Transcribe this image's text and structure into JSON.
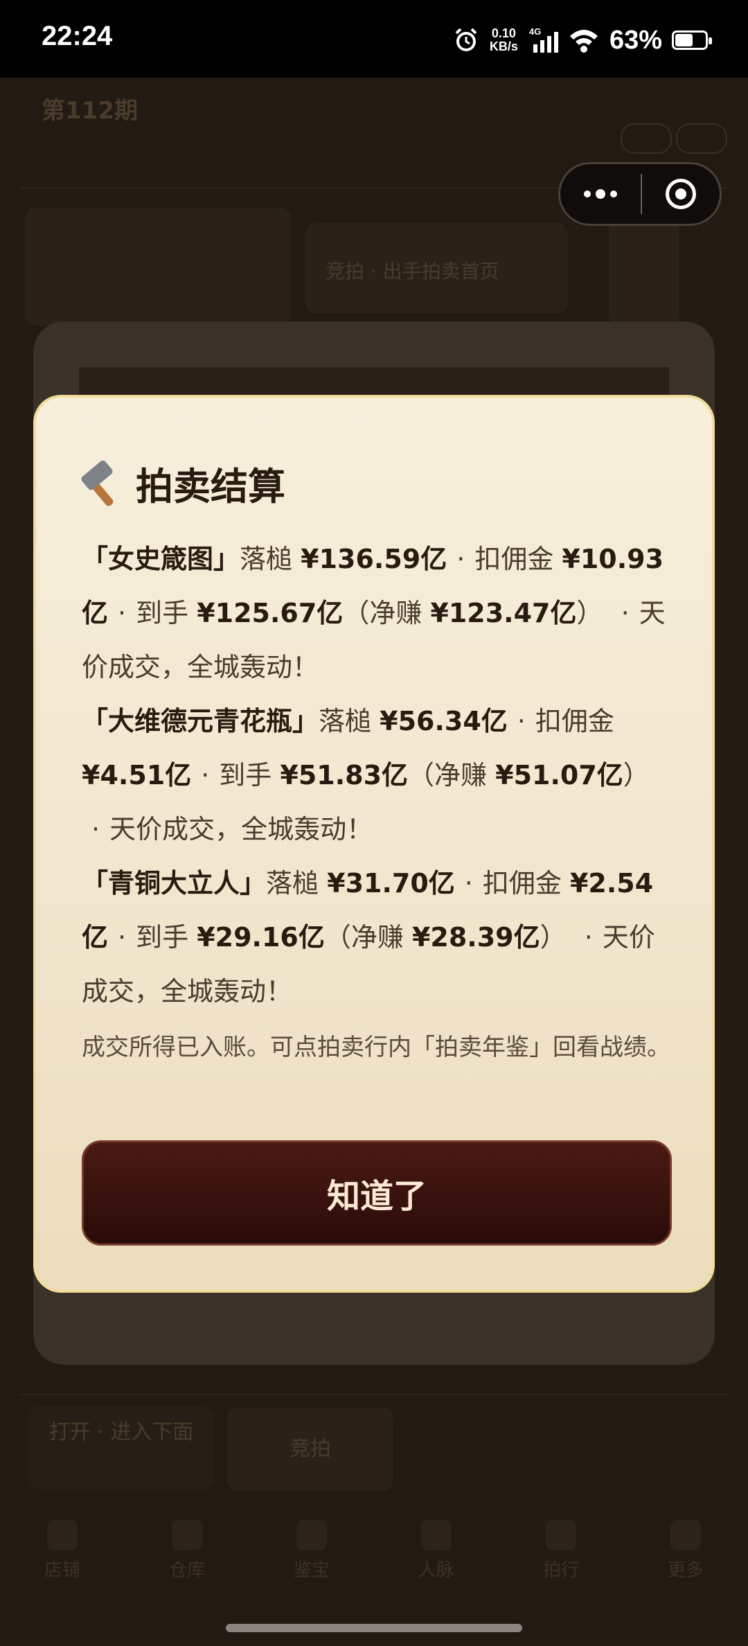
{
  "status_bar": {
    "time": "22:24",
    "net_speed_value": "0.10",
    "net_speed_unit": "KB/s",
    "network": "4G",
    "battery_percent_text": "63%",
    "battery_level": 0.63,
    "icons": [
      "alarm-icon",
      "signal-icon",
      "wifi-icon",
      "battery-icon"
    ]
  },
  "background_page": {
    "issue_title": "第112期",
    "issue_subtitle": "",
    "line2": "",
    "line3": "",
    "card_b_label": "竞拍 · 出手拍卖首页",
    "bottom_left_btn": "打开 · 进入下面",
    "bottom_mid_btn": "竞拍",
    "tabs": [
      "店铺",
      "仓库",
      "鉴宝",
      "人脉",
      "拍行",
      "更多"
    ]
  },
  "capsule": {
    "more_icon": "more-dots-icon",
    "close_icon": "target-close-icon"
  },
  "dialog": {
    "title": "拍卖结算",
    "title_icon": "hammer-icon",
    "results": [
      {
        "name": "「女史箴图」",
        "hammer_label": "落槌",
        "hammer_price": "¥136.59亿",
        "commission_label": "扣佣金",
        "commission": "¥10.93亿",
        "received_label": "到手",
        "received": "¥125.67亿",
        "net_label": "（净赚",
        "net": "¥123.47亿",
        "net_close": "）",
        "remark": "天价成交，全城轰动！"
      },
      {
        "name": "「大维德元青花瓶」",
        "hammer_label": "落槌",
        "hammer_price": "¥56.34亿",
        "commission_label": "扣佣金",
        "commission": "¥4.51亿",
        "received_label": "到手",
        "received": "¥51.83亿",
        "net_label": "（净赚",
        "net": "¥51.07亿",
        "net_close": "）",
        "remark": "天价成交，全城轰动！"
      },
      {
        "name": "「青铜大立人」",
        "hammer_label": "落槌",
        "hammer_price": "¥31.70亿",
        "commission_label": "扣佣金",
        "commission": "¥2.54亿",
        "received_label": "到手",
        "received": "¥29.16亿",
        "net_label": "（净赚",
        "net": "¥28.39亿",
        "net_close": "）",
        "remark": "天价成交，全城轰动！"
      }
    ],
    "separator": "·",
    "note": "成交所得已入账。可点拍卖行内「拍卖年鉴」回看战绩。",
    "confirm_label": "知道了"
  },
  "colors": {
    "dialog_bg": "#f7efdc",
    "dialog_border": "#f1dc99",
    "button_bg": "#2a0b08",
    "button_text": "#fbe9d3",
    "overlay_bg": "#1d1712"
  }
}
